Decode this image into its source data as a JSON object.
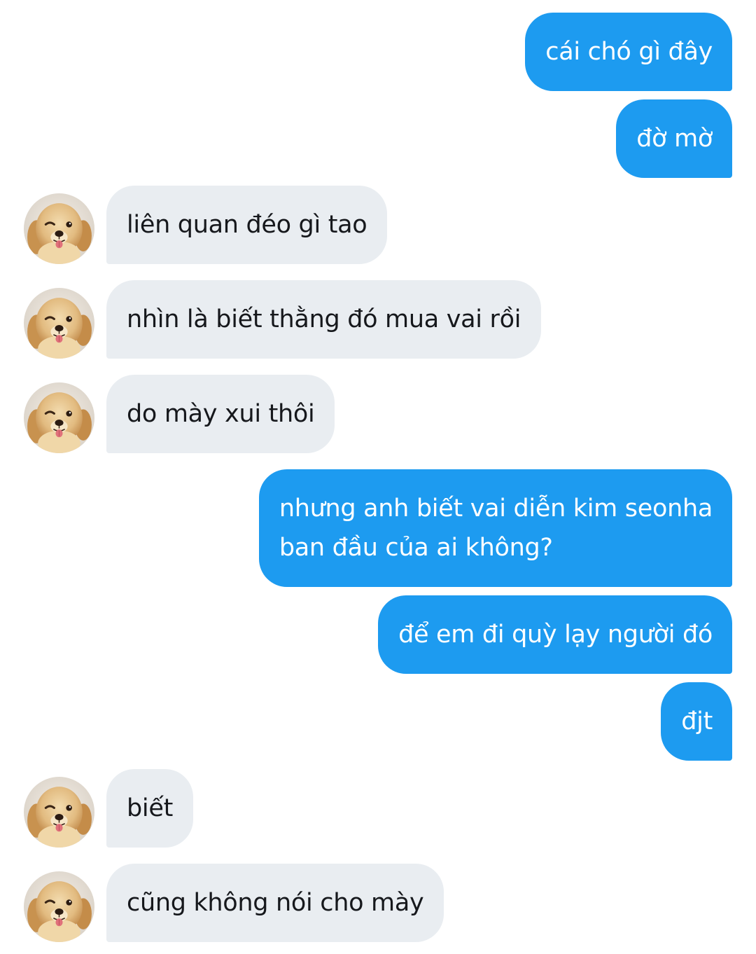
{
  "conversation": {
    "messages": [
      {
        "side": "out",
        "text": "cái chó gì đây"
      },
      {
        "side": "out",
        "text": "đờ mờ"
      },
      {
        "side": "in",
        "text": "liên quan đéo gì tao"
      },
      {
        "side": "in",
        "text": "nhìn là biết thằng đó mua vai rồi"
      },
      {
        "side": "in",
        "text": "do mày xui thôi"
      },
      {
        "side": "out",
        "text": "nhưng anh biết vai diễn kim seonha ban đầu của ai không?",
        "lines": [
          "nhưng anh biết vai diễn kim seonha",
          "ban đầu của ai không?"
        ]
      },
      {
        "side": "out",
        "text": "để em đi quỳ lạy người đó"
      },
      {
        "side": "out",
        "text": "đjt"
      },
      {
        "side": "in",
        "text": "biết"
      },
      {
        "side": "in",
        "text": "cũng không nói cho mày"
      }
    ]
  },
  "avatar_icon": "golden-retriever-puppy-photo",
  "colors": {
    "outgoing_bubble": "#1d9bf0",
    "incoming_bubble": "#e9edf1",
    "outgoing_text": "#ffffff",
    "incoming_text": "#16181c"
  }
}
